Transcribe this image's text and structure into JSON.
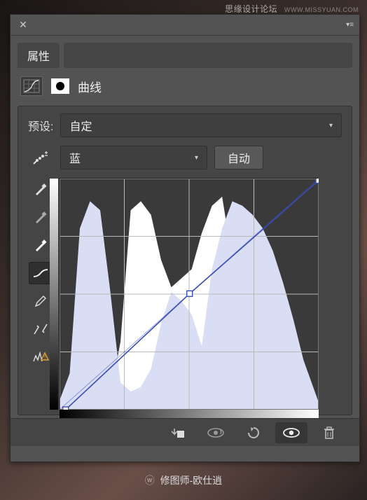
{
  "watermark": {
    "text": "思缘设计论坛",
    "url_text": "WWW.MISSYUAN.COM"
  },
  "panel": {
    "tab": "属性",
    "adjustment_type": "曲线",
    "preset_label": "预设:",
    "preset_value": "自定",
    "channel_value": "蓝",
    "auto_label": "自动"
  },
  "credit": "修图师-欧仕逍",
  "chart_data": {
    "type": "curve-histogram",
    "title": "",
    "xlabel": "",
    "ylabel": "",
    "xlim": [
      0,
      255
    ],
    "ylim": [
      0,
      255
    ],
    "grid": true,
    "curve_points": [
      {
        "x": 6,
        "y": 0
      },
      {
        "x": 128,
        "y": 128
      },
      {
        "x": 255,
        "y": 253
      }
    ],
    "baseline": [
      {
        "x": 0,
        "y": 0
      },
      {
        "x": 255,
        "y": 255
      }
    ],
    "histogram_top": {
      "color": "#3a3a3a",
      "bins_x": [
        0,
        10,
        20,
        30,
        40,
        50,
        60,
        70,
        80,
        90,
        100,
        110,
        120,
        130,
        140,
        150,
        160,
        170,
        180,
        190,
        200,
        210,
        220,
        230,
        240,
        255
      ],
      "values": [
        255,
        255,
        255,
        250,
        255,
        240,
        180,
        35,
        25,
        40,
        90,
        120,
        110,
        100,
        60,
        30,
        20,
        90,
        200,
        240,
        255,
        255,
        255,
        255,
        255,
        255
      ]
    },
    "histogram_bottom": {
      "color": "#dadef5",
      "bins_x": [
        0,
        10,
        20,
        30,
        40,
        50,
        60,
        70,
        80,
        90,
        100,
        110,
        120,
        130,
        140,
        150,
        160,
        170,
        180,
        190,
        200,
        210,
        220,
        230,
        240,
        255
      ],
      "values": [
        10,
        40,
        200,
        230,
        220,
        130,
        30,
        20,
        25,
        45,
        95,
        130,
        120,
        105,
        70,
        155,
        200,
        230,
        225,
        215,
        200,
        175,
        140,
        100,
        55,
        8
      ]
    }
  }
}
